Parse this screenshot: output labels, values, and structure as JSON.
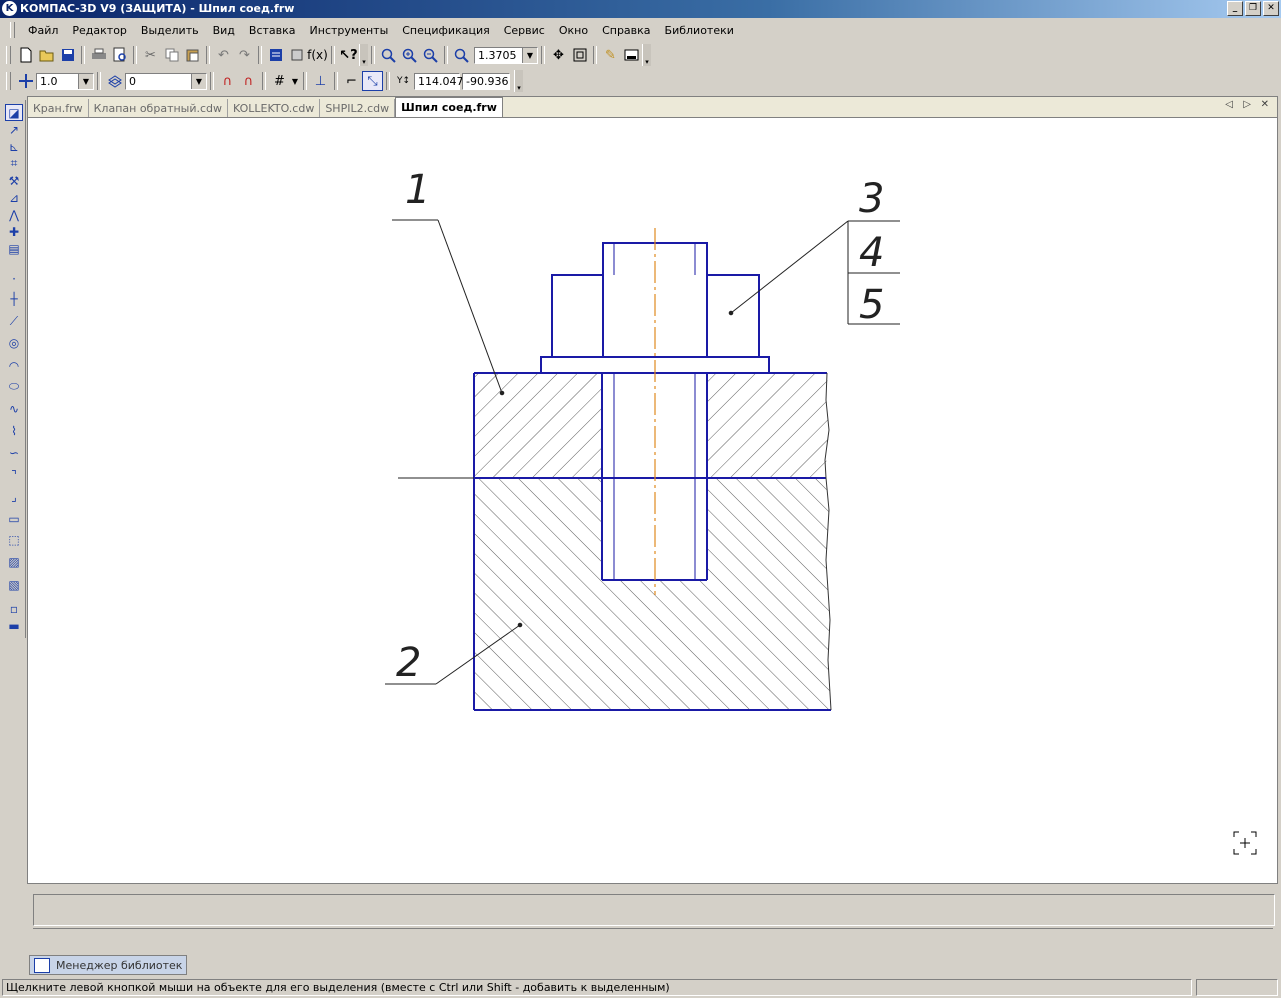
{
  "app": {
    "logo_letter": "K",
    "title": "КОМПАС-3D V9 (ЗАЩИТА) - Шпил соед.frw",
    "window_buttons": [
      "_",
      "❐",
      "✕"
    ]
  },
  "menu": {
    "items": [
      "Файл",
      "Редактор",
      "Выделить",
      "Вид",
      "Вставка",
      "Инструменты",
      "Спецификация",
      "Сервис",
      "Окно",
      "Справка",
      "Библиотеки"
    ]
  },
  "toolbar1": {
    "zoom_value": "1.3705"
  },
  "toolbar2": {
    "step_value": "1.0",
    "layer_value": "0",
    "coord_x": "114.047",
    "coord_y": "-90.936"
  },
  "document": {
    "tabs": [
      {
        "label": "Кран.frw",
        "active": false
      },
      {
        "label": "Клапан обратный.cdw",
        "active": false
      },
      {
        "label": "KOLLEKTO.cdw",
        "active": false
      },
      {
        "label": "SHPIL2.cdw",
        "active": false
      },
      {
        "label": "Шпил соед.frw",
        "active": true
      }
    ],
    "tab_controls": [
      "◁",
      "▷",
      "✕"
    ]
  },
  "drawing": {
    "leader_labels": [
      "1",
      "2",
      "3",
      "4",
      "5"
    ],
    "line_color": "#1a1aa6",
    "axis_color": "#e08a1e"
  },
  "library_tab": {
    "label": "Менеджер библиотек"
  },
  "status": {
    "text": "Щелкните левой кнопкой мыши на объекте для его выделения (вместе с Ctrl или Shift - добавить к выделенным)"
  }
}
